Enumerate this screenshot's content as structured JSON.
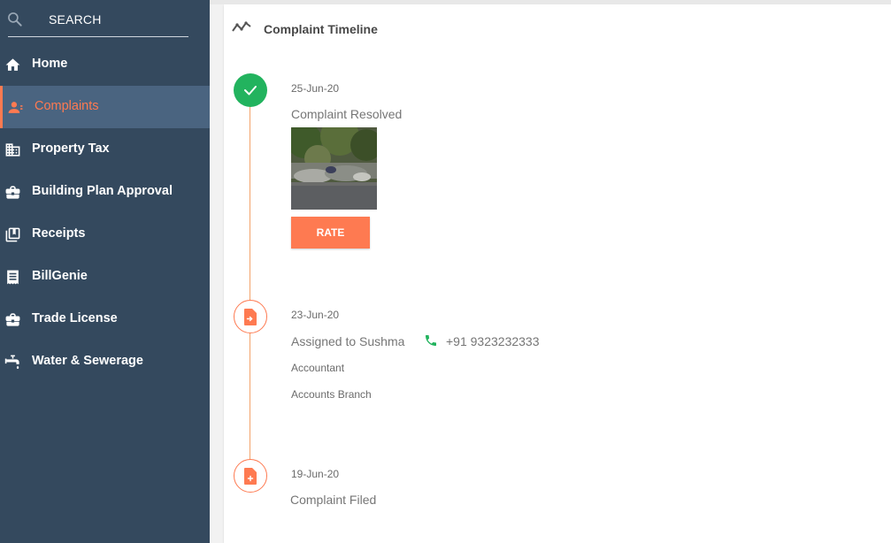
{
  "search": {
    "label": "SEARCH"
  },
  "sidebar": {
    "items": [
      {
        "label": "Home",
        "icon": "home-icon",
        "active": false
      },
      {
        "label": "Complaints",
        "icon": "user-icon",
        "active": true
      },
      {
        "label": "Property Tax",
        "icon": "building-icon",
        "active": false
      },
      {
        "label": "Building Plan Approval",
        "icon": "briefcase-icon",
        "active": false
      },
      {
        "label": "Receipts",
        "icon": "receipts-icon",
        "active": false
      },
      {
        "label": "BillGenie",
        "icon": "bill-icon",
        "active": false
      },
      {
        "label": "Trade License",
        "icon": "briefcase-icon",
        "active": false
      },
      {
        "label": "Water & Sewerage",
        "icon": "tap-icon",
        "active": false
      }
    ]
  },
  "timeline": {
    "title": "Complaint Timeline",
    "events": [
      {
        "date": "25-Jun-20",
        "status": "Complaint Resolved",
        "action": "RATE"
      },
      {
        "date": "23-Jun-20",
        "status": "Assigned to Sushma",
        "phone": "+91 9323232333",
        "designation": "Accountant",
        "department": "Accounts Branch"
      },
      {
        "date": "19-Jun-20",
        "status": "Complaint Filed"
      }
    ]
  },
  "colors": {
    "sidebar_bg": "#34495e",
    "accent": "#fe7a51",
    "success": "#22b35e"
  }
}
